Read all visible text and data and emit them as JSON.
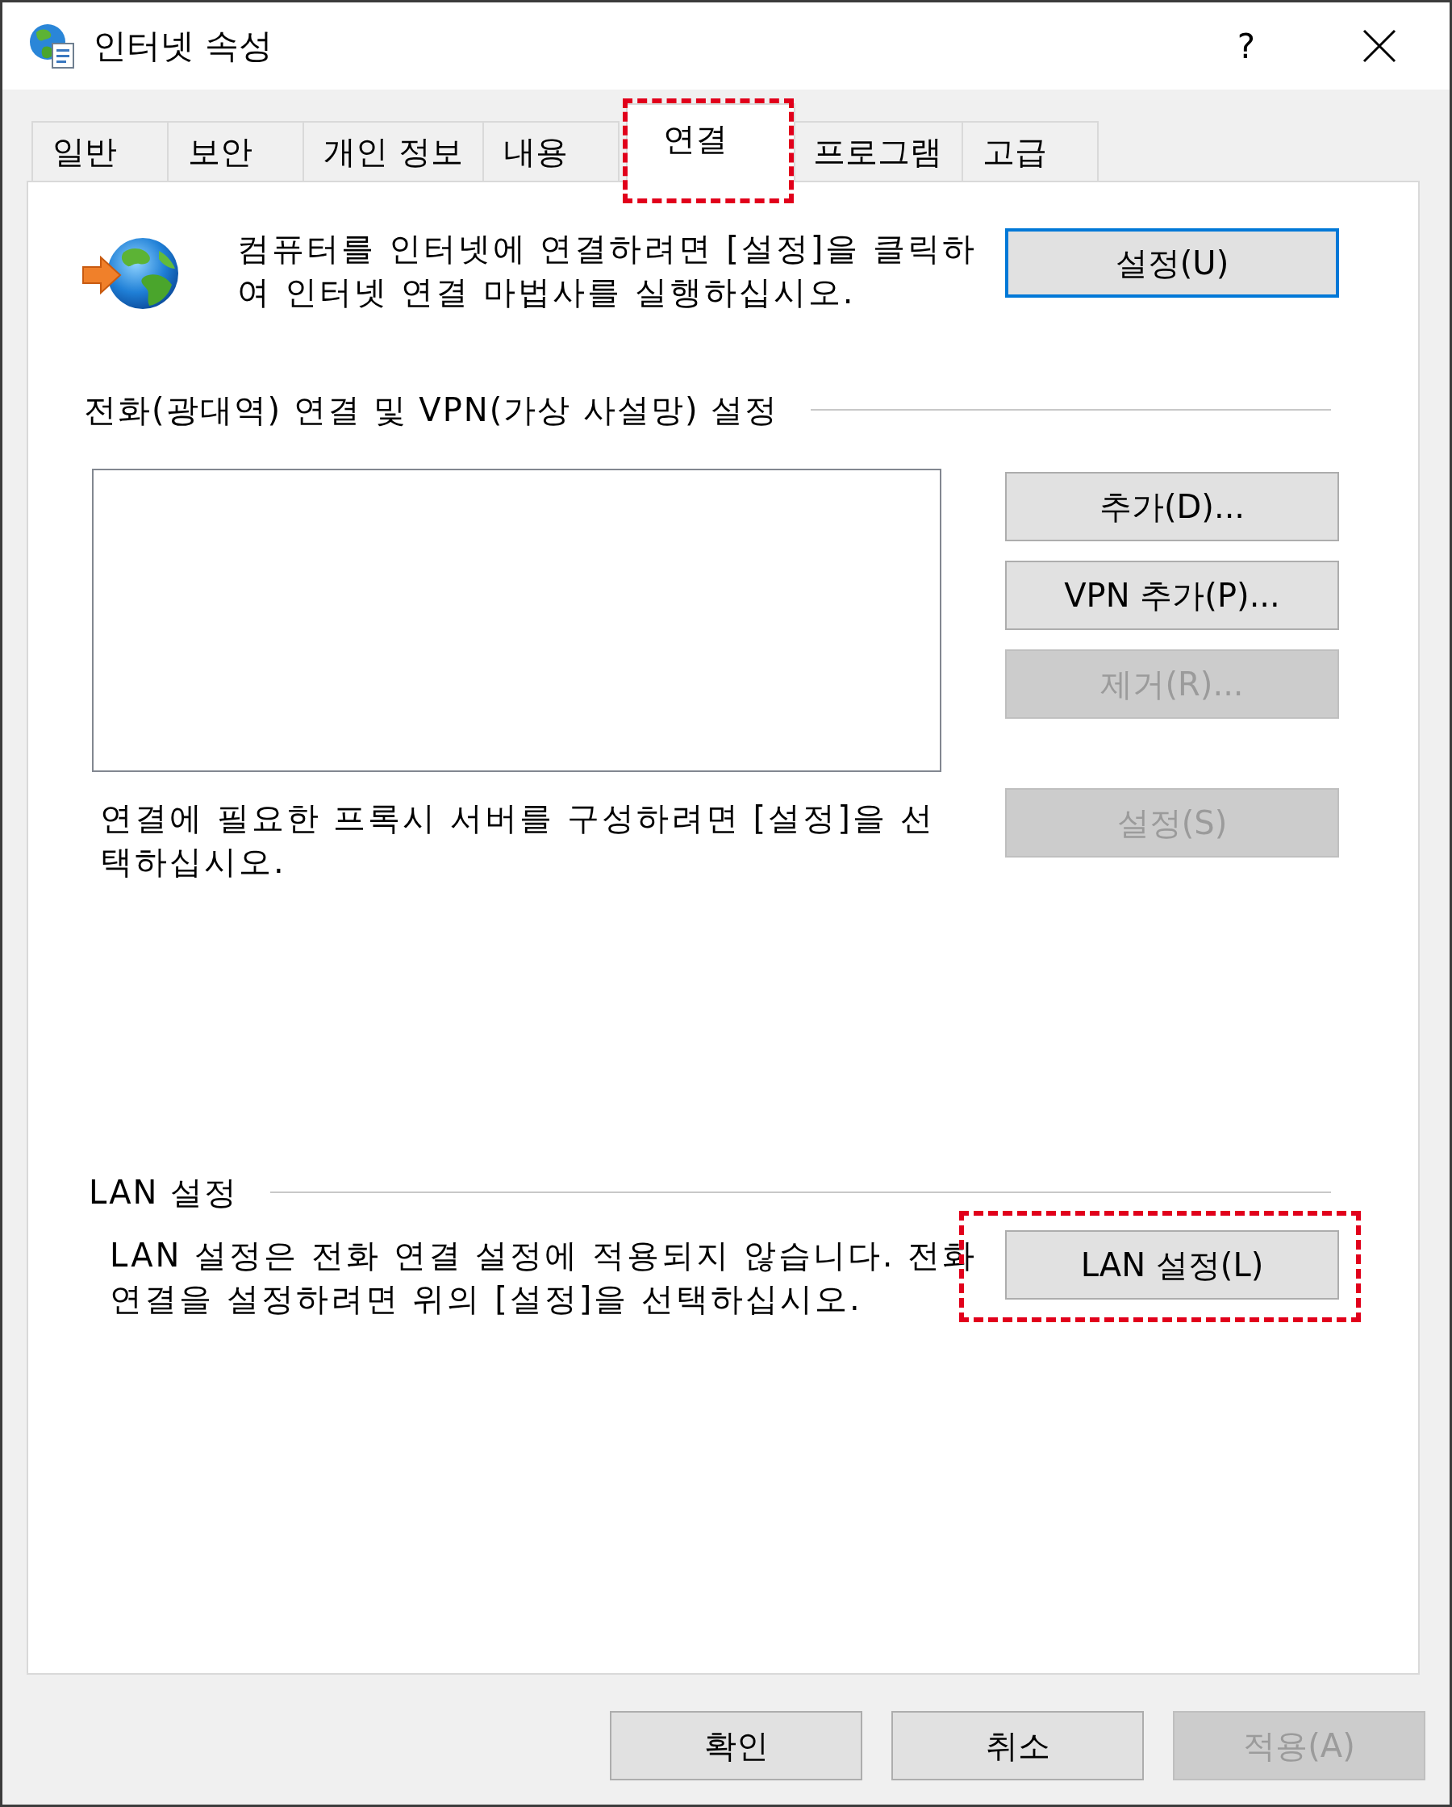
{
  "window": {
    "title": "인터넷 속성",
    "help_label": "?"
  },
  "tabs": [
    {
      "label": "일반",
      "selected": false,
      "highlighted": false
    },
    {
      "label": "보안",
      "selected": false,
      "highlighted": false
    },
    {
      "label": "개인 정보",
      "selected": false,
      "highlighted": false
    },
    {
      "label": "내용",
      "selected": false,
      "highlighted": false
    },
    {
      "label": "연결",
      "selected": true,
      "highlighted": true
    },
    {
      "label": "프로그램",
      "selected": false,
      "highlighted": false
    },
    {
      "label": "고급",
      "selected": false,
      "highlighted": false
    }
  ],
  "setup": {
    "text": "컴퓨터를 인터넷에 연결하려면 [설정]을 클릭하여 인터넷 연결 마법사를 실행하십시오.",
    "button": {
      "label": "설정(U)",
      "default": true,
      "disabled": false
    }
  },
  "dialup": {
    "heading": "전화(광대역) 연결 및 VPN(가상 사설망) 설정",
    "buttons": [
      {
        "label": "추가(D)...",
        "disabled": false
      },
      {
        "label": "VPN 추가(P)...",
        "disabled": false
      },
      {
        "label": "제거(R)...",
        "disabled": true
      }
    ],
    "proxy_text": "연결에 필요한 프록시 서버를 구성하려면 [설정]을 선택하십시오.",
    "proxy_button": {
      "label": "설정(S)",
      "disabled": true
    }
  },
  "lan": {
    "heading": "LAN 설정",
    "text": "LAN 설정은 전화 연결 설정에 적용되지 않습니다. 전화 연결을 설정하려면 위의 [설정]을 선택하십시오.",
    "button": {
      "label": "LAN 설정(L)",
      "disabled": false,
      "highlighted": true
    }
  },
  "footer_buttons": [
    {
      "label": "확인",
      "disabled": false
    },
    {
      "label": "취소",
      "disabled": false
    },
    {
      "label": "적용(A)",
      "disabled": true
    }
  ]
}
